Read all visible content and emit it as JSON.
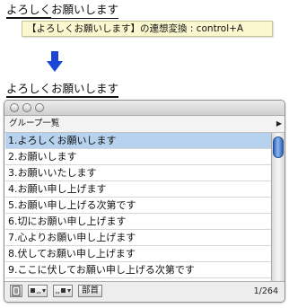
{
  "input_top": {
    "underlined_thick": "よろしく",
    "underlined_thin": "お願いします"
  },
  "tooltip": {
    "text": "【よろしくお願いします】の連想変換 : control+A"
  },
  "input_bottom": {
    "text": "よろしくお願いします"
  },
  "panel": {
    "group_label": "グループ一覧",
    "items": [
      {
        "label": "1.よろしくお願いします",
        "selected": true
      },
      {
        "label": "2.お願いします",
        "selected": false
      },
      {
        "label": "3.お願いいたします",
        "selected": false
      },
      {
        "label": "4.お願い申し上げます",
        "selected": false
      },
      {
        "label": "5.お願い申し上げる次第です",
        "selected": false
      },
      {
        "label": "6.切にお願い申し上げます",
        "selected": false
      },
      {
        "label": "7.心よりお願い申し上げます",
        "selected": false
      },
      {
        "label": "8.伏してお願い申し上げます",
        "selected": false
      },
      {
        "label": "9.ここに伏してお願い申し上げる次第です",
        "selected": false
      }
    ],
    "radical_button": "部首",
    "count": "1/264"
  },
  "colors": {
    "selection": "#b6d2ee",
    "tooltip_bg": "#fbf7cf",
    "arrow": "#1a45d6",
    "scroll_thumb": "#2f63b6"
  },
  "icons": {
    "arrow": "down-arrow-icon",
    "page": "page-icon",
    "prev": "prev-candidate-icon",
    "next": "next-candidate-icon",
    "group_menu": "triangle-right-icon"
  }
}
